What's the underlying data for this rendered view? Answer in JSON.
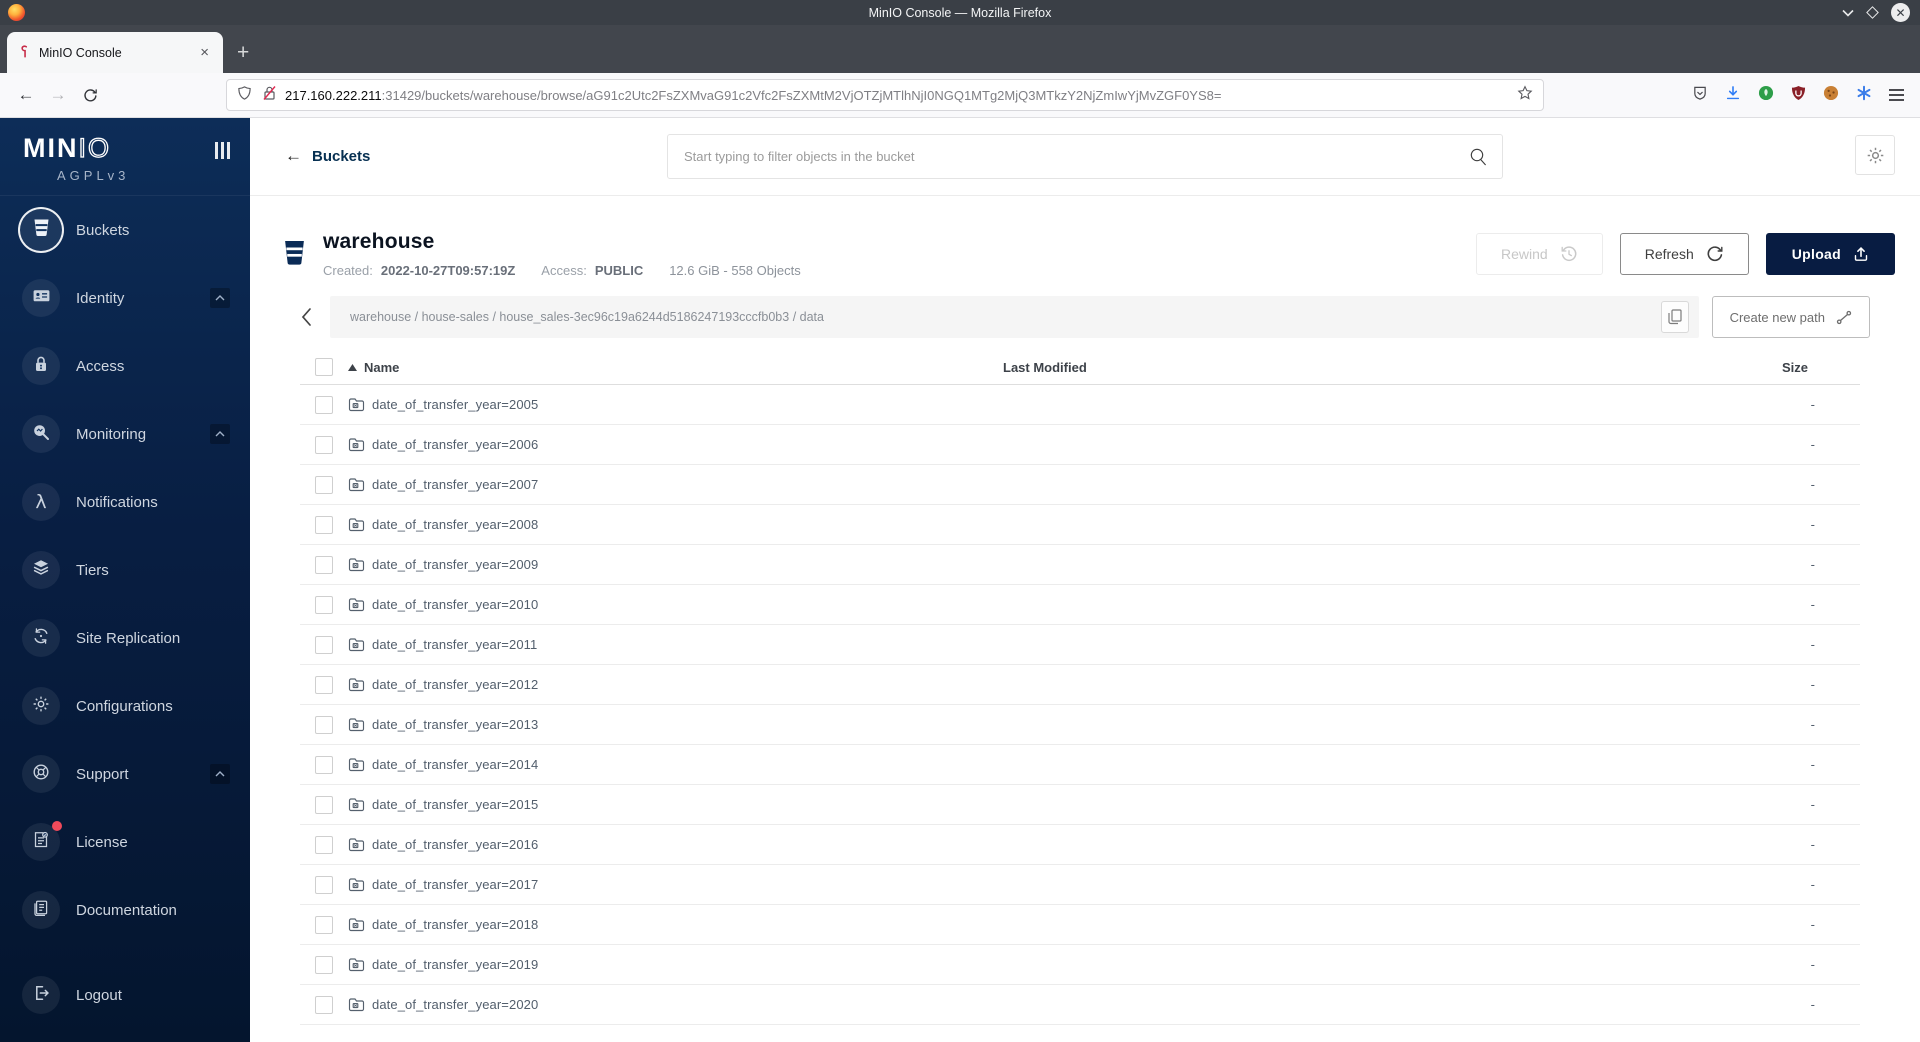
{
  "browser": {
    "window_title": "MinIO Console — Mozilla Firefox",
    "tab_title": "MinIO Console",
    "tab_close_glyph": "×",
    "new_tab_label": "+",
    "url_host": "217.160.222.211",
    "url_rest": ":31429/buckets/warehouse/browse/aG91c2Utc2FsZXMvaG91c2Vfc2FsZXMtM2VjOTZjMTlhNjI0NGQ1MTg2MjQ3MTkzY2NjZmIwYjMvZGF0YS8="
  },
  "sidebar": {
    "logo_bold": "MIN",
    "logo_outline": "IO",
    "license_tag": "AGPLv3",
    "items": [
      {
        "label": "Buckets",
        "icon": "bucket-icon",
        "active": true,
        "expandable": false,
        "badge": false
      },
      {
        "label": "Identity",
        "icon": "identity-card-icon",
        "active": false,
        "expandable": true,
        "badge": false
      },
      {
        "label": "Access",
        "icon": "lock-icon",
        "active": false,
        "expandable": false,
        "badge": false
      },
      {
        "label": "Monitoring",
        "icon": "monitoring-magnifier-icon",
        "active": false,
        "expandable": true,
        "badge": false
      },
      {
        "label": "Notifications",
        "icon": "lambda-icon",
        "active": false,
        "expandable": false,
        "badge": false
      },
      {
        "label": "Tiers",
        "icon": "layers-icon",
        "active": false,
        "expandable": false,
        "badge": false
      },
      {
        "label": "Site Replication",
        "icon": "replication-arrows-icon",
        "active": false,
        "expandable": false,
        "badge": false
      },
      {
        "label": "Configurations",
        "icon": "gear-icon",
        "active": false,
        "expandable": false,
        "badge": false
      },
      {
        "label": "Support",
        "icon": "lifebuoy-icon",
        "active": false,
        "expandable": true,
        "badge": false
      },
      {
        "label": "License",
        "icon": "license-document-icon",
        "active": false,
        "expandable": false,
        "badge": true
      },
      {
        "label": "Documentation",
        "icon": "documentation-book-icon",
        "active": false,
        "expandable": false,
        "badge": false
      },
      {
        "label": "Logout",
        "icon": "logout-icon",
        "active": false,
        "expandable": false,
        "badge": false,
        "gap_before": true
      }
    ]
  },
  "topbar": {
    "back_label": "Buckets",
    "search_placeholder": "Start typing to filter objects in the bucket"
  },
  "bucket": {
    "title": "warehouse",
    "created_label": "Created:",
    "created_value": "2022-10-27T09:57:19Z",
    "access_label": "Access:",
    "access_value": "PUBLIC",
    "usage_text": "12.6 GiB - 558 Objects",
    "rewind_label": "Rewind",
    "refresh_label": "Refresh",
    "upload_label": "Upload"
  },
  "path_bar": {
    "display": "warehouse / house-sales / house_sales-3ec96c19a6244d5186247193cccfb0b3 / data",
    "segments": [
      "warehouse",
      "house-sales",
      "house_sales-3ec96c19a6244d5186247193cccfb0b3",
      "data"
    ],
    "create_label": "Create new path"
  },
  "table": {
    "name_header": "Name",
    "last_modified_header": "Last Modified",
    "size_header": "Size",
    "rows": [
      {
        "name": "date_of_transfer_year=2005",
        "size": "-"
      },
      {
        "name": "date_of_transfer_year=2006",
        "size": "-"
      },
      {
        "name": "date_of_transfer_year=2007",
        "size": "-"
      },
      {
        "name": "date_of_transfer_year=2008",
        "size": "-"
      },
      {
        "name": "date_of_transfer_year=2009",
        "size": "-"
      },
      {
        "name": "date_of_transfer_year=2010",
        "size": "-"
      },
      {
        "name": "date_of_transfer_year=2011",
        "size": "-"
      },
      {
        "name": "date_of_transfer_year=2012",
        "size": "-"
      },
      {
        "name": "date_of_transfer_year=2013",
        "size": "-"
      },
      {
        "name": "date_of_transfer_year=2014",
        "size": "-"
      },
      {
        "name": "date_of_transfer_year=2015",
        "size": "-"
      },
      {
        "name": "date_of_transfer_year=2016",
        "size": "-"
      },
      {
        "name": "date_of_transfer_year=2017",
        "size": "-"
      },
      {
        "name": "date_of_transfer_year=2018",
        "size": "-"
      },
      {
        "name": "date_of_transfer_year=2019",
        "size": "-"
      },
      {
        "name": "date_of_transfer_year=2020",
        "size": "-"
      }
    ]
  },
  "colors": {
    "sidebar_navy": "#081C42",
    "accent_navy": "#073052",
    "upload_button_bg": "#081C42",
    "brand_red": "#C72C48",
    "badge_red": "#F04A5B",
    "download_blue": "#2E7CF6"
  }
}
